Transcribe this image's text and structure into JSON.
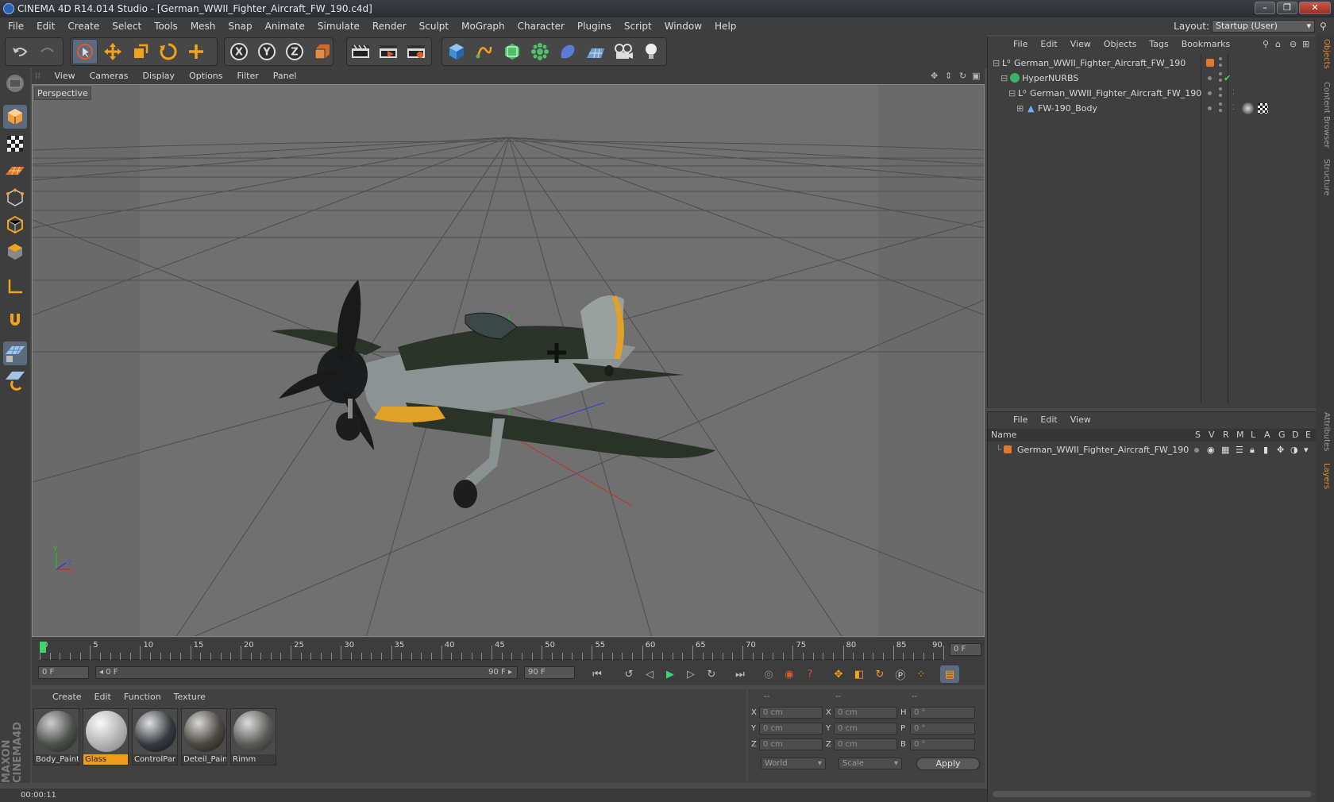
{
  "window": {
    "title": "CINEMA 4D R14.014 Studio - [German_WWII_Fighter_Aircraft_FW_190.c4d]",
    "min": "–",
    "max": "❐",
    "close": "✕"
  },
  "menubar": {
    "items": [
      "File",
      "Edit",
      "Create",
      "Select",
      "Tools",
      "Mesh",
      "Snap",
      "Animate",
      "Simulate",
      "Render",
      "Sculpt",
      "MoGraph",
      "Character",
      "Plugins",
      "Script",
      "Window",
      "Help"
    ],
    "layout_label": "Layout:",
    "layout_value": "Startup (User)"
  },
  "viewport": {
    "menu": [
      "View",
      "Cameras",
      "Display",
      "Options",
      "Filter",
      "Panel"
    ],
    "label": "Perspective",
    "axis_y": "Y",
    "axis_z": "Z",
    "axis_x": "X"
  },
  "timeline": {
    "ticks": [
      "0",
      "5",
      "10",
      "15",
      "20",
      "25",
      "30",
      "35",
      "40",
      "45",
      "50",
      "55",
      "60",
      "65",
      "70",
      "75",
      "80",
      "85",
      "90"
    ],
    "current_frame": "0 F",
    "start_field": "0 F",
    "range_start": "◂ 0 F",
    "range_end": "90 F ▸",
    "end_field": "90 F"
  },
  "materials": {
    "menu": [
      "Create",
      "Edit",
      "Function",
      "Texture"
    ],
    "items": [
      {
        "name": "Body_Paint",
        "active": false
      },
      {
        "name": "Glass",
        "active": true
      },
      {
        "name": "ControlPar",
        "active": false
      },
      {
        "name": "Deteil_Pain",
        "active": false
      },
      {
        "name": "Rimm",
        "active": false
      }
    ]
  },
  "coordinates": {
    "headers": [
      "--",
      "--",
      "--"
    ],
    "rows": [
      {
        "a": "X",
        "av": "0 cm",
        "b": "X",
        "bv": "0 cm",
        "c": "H",
        "cv": "0 °"
      },
      {
        "a": "Y",
        "av": "0 cm",
        "b": "Y",
        "bv": "0 cm",
        "c": "P",
        "cv": "0 °"
      },
      {
        "a": "Z",
        "av": "0 cm",
        "b": "Z",
        "bv": "0 cm",
        "c": "B",
        "cv": "0 °"
      }
    ],
    "world": "World",
    "scale": "Scale",
    "apply": "Apply"
  },
  "status": {
    "time": "00:00:11"
  },
  "objects": {
    "menu": [
      "File",
      "Edit",
      "View",
      "Objects",
      "Tags",
      "Bookmarks"
    ],
    "tree": [
      {
        "name": "German_WWII_Fighter_Aircraft_FW_190",
        "indent": 0
      },
      {
        "name": "HyperNURBS",
        "indent": 1
      },
      {
        "name": "German_WWII_Fighter_Aircraft_FW_190",
        "indent": 2
      },
      {
        "name": "FW-190_Body",
        "indent": 3
      }
    ]
  },
  "layers": {
    "menu": [
      "File",
      "Edit",
      "View"
    ],
    "name_header": "Name",
    "col_headers": [
      "S",
      "V",
      "R",
      "M",
      "L",
      "A",
      "G",
      "D",
      "E"
    ],
    "rows": [
      {
        "name": "German_WWII_Fighter_Aircraft_FW_190"
      }
    ]
  },
  "right_tabs": [
    "Objects",
    "Content Browser",
    "Structure",
    "Attributes",
    "Layers"
  ],
  "colors": {
    "accent": "#f39c1b",
    "selection": "#5b6a7d",
    "viewport": "#6b6b6b"
  }
}
